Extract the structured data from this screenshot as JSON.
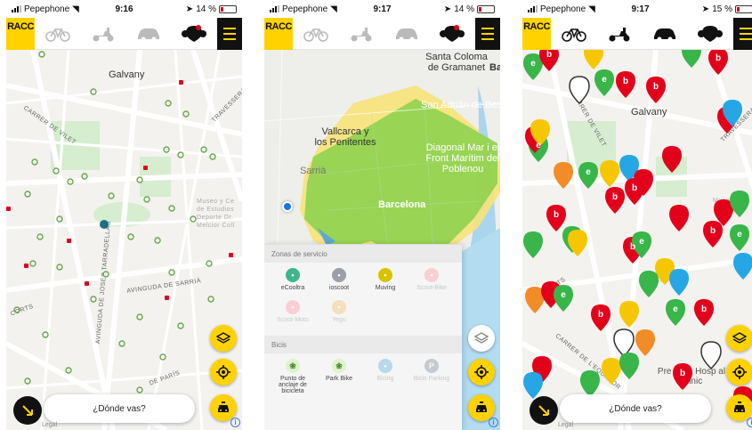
{
  "status": {
    "carrier": "Pepephone",
    "screens": [
      {
        "time": "9:16",
        "battery": "14 %"
      },
      {
        "time": "9:17",
        "battery": "14 %"
      },
      {
        "time": "9:17",
        "battery": "15 %"
      }
    ]
  },
  "header": {
    "logo": "RACC",
    "modes": [
      "bike-icon",
      "scooter-icon",
      "car-icon",
      "multimodal-icon"
    ]
  },
  "screen1": {
    "labels": {
      "galvany": "Galvany",
      "carrer_vilet": "CARRER DE VILET",
      "travessera": "TRAVESSERA",
      "museo": "Museo y Ce de Estudios Deporte Dr. Melcior Coll",
      "avinguda_sarria": "AVINGUDA DE SARRIÀ",
      "avinguda_josep": "AVINGUDA DE JOSEP TARRADELLAS",
      "corts": "CORTS",
      "paris": "DE PARÍS"
    },
    "search_placeholder": "¿Dónde vas?",
    "legal": "Legal"
  },
  "screen2": {
    "labels": {
      "santa_coloma": "Santa Coloma de Gramanet",
      "ba": "Ba",
      "san_adrian": "San Adrián de Besó",
      "vallcarca": "Vallcarca y los Penitentes",
      "diagonal": "Diagonal Mar i el Front Marítim del Poblenou",
      "sarria": "Sarrià",
      "barcelona": "Barcelona"
    },
    "panel": {
      "section_zones": "Zonas de servicio",
      "zones": [
        {
          "label": "eCooltra",
          "color": "#3fb58d",
          "active": true
        },
        {
          "label": "ioscoot",
          "color": "#9aa0a6",
          "active": true
        },
        {
          "label": "Muving",
          "color": "#d9c300",
          "active": true
        },
        {
          "label": "Scoot-Bike",
          "color": "#ff8a9a",
          "active": false
        },
        {
          "label": "Scoot-Moto",
          "color": "#ff8a9a",
          "active": false
        },
        {
          "label": "Yego",
          "color": "#f2b84b",
          "active": false
        }
      ],
      "section_bikes": "Bicis",
      "bikes": [
        {
          "label": "Punto de anclaje de bicicleta",
          "color": "#7bc043",
          "active": true
        },
        {
          "label": "Park Bike",
          "color": "#7bc043",
          "active": true
        },
        {
          "label": "Bicing",
          "color": "#4aa3df",
          "active": false
        },
        {
          "label": "Bicis Parking",
          "color": "#6b7b8c",
          "active": false
        }
      ]
    }
  },
  "screen3": {
    "labels": {
      "galvany": "Galvany",
      "carrer_vilet": "CARRER DE VILET",
      "travessera": "TRAVESSERA",
      "museu": "Museu",
      "corts": "CORTS",
      "carrer_equador": "CARRER DE L'EQUADOR",
      "area": "Pre Área Hosp al Clinic"
    },
    "search_placeholder": "¿Dónde vas?",
    "legal": "Legal"
  },
  "colors": {
    "brand_yellow": "#ffd200",
    "black": "#111111",
    "bike_green": "#7bc043",
    "pin_red": "#e3001b",
    "pin_green": "#39b54a",
    "pin_blue": "#27a6e5",
    "pin_orange": "#f28c28",
    "zone_green": "#8fd14f",
    "zone_yellow": "#f6e27a"
  }
}
